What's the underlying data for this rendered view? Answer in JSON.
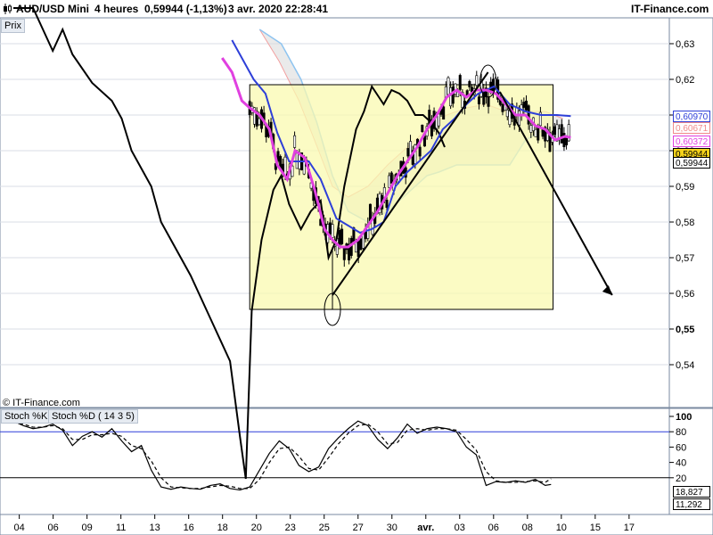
{
  "header": {
    "symbol": "AUD/USD Mini",
    "timeframe": "4 heures",
    "last_quote": "0,59944 (-1,13%)",
    "datetime": "3 avr. 2020 22:28:41",
    "brand": "IT-Finance.com"
  },
  "price_panel": {
    "tag": "Prix",
    "copyright": "© IT-Finance.com",
    "y_ticks": [
      "0,63",
      "0,62",
      "0,61",
      "0,60",
      "0,59",
      "0,58",
      "0,57",
      "0,56",
      "0,55",
      "0,54"
    ],
    "y_tick_values": [
      0.63,
      0.62,
      0.61,
      0.6,
      0.59,
      0.58,
      0.57,
      0.56,
      0.55,
      0.54
    ],
    "badges": [
      {
        "label": "0,60970",
        "value": 0.6097,
        "color": "#2e3fd8",
        "bg": "#ffffff"
      },
      {
        "label": "0,60671",
        "value": 0.60671,
        "color": "#f08a8a",
        "bg": "#ffffff"
      },
      {
        "label": "0,60372",
        "value": 0.60372,
        "color": "#e040e0",
        "bg": "#ffffff"
      },
      {
        "label": "0,59944",
        "value": 0.59944,
        "color": "#000000",
        "bg": "#f5d21a"
      },
      {
        "label": "0,59944",
        "value": 0.59944,
        "color": "#000000",
        "bg": "#ffffff"
      }
    ]
  },
  "stoch_panel": {
    "tag_k": "Stoch %K",
    "tag_d": "Stoch %D ( 14 3 5)",
    "y_ticks": [
      "100",
      "80",
      "60",
      "40",
      "20"
    ],
    "y_tick_values": [
      100,
      80,
      60,
      40,
      20
    ],
    "badges": [
      {
        "label": "18,827",
        "value": 18.827
      },
      {
        "label": "11,292",
        "value": 11.292
      }
    ]
  },
  "x_axis": {
    "labels": [
      "04",
      "06",
      "09",
      "11",
      "13",
      "16",
      "18",
      "20",
      "23",
      "25",
      "27",
      "30",
      "avr.",
      "03",
      "06",
      "08",
      "10",
      "15",
      "17"
    ]
  },
  "chart_data": [
    {
      "type": "candlestick",
      "title": "AUD/USD Mini",
      "ylim": [
        0.532,
        0.635
      ],
      "grid": true,
      "overlays": {
        "yellow_zone": {
          "x": [
            12,
            27.4
          ],
          "y": [
            0.5555,
            0.6185
          ]
        },
        "ellipses": [
          {
            "x": 16.2,
            "y": 0.5555
          },
          {
            "x": 24.1,
            "y": 0.6195
          }
        ],
        "trendlines": [
          {
            "x": [
              16.2,
              24.1
            ],
            "y": [
              0.5595,
              0.622
            ]
          },
          {
            "x": [
              24.7,
              30.4
            ],
            "y": [
              0.6165,
              0.5595
            ]
          }
        ]
      },
      "series": [
        {
          "name": "close",
          "values": [
            [
              0,
              0.64
            ],
            [
              1,
              0.64
            ],
            [
              2,
              0.628
            ],
            [
              2.5,
              0.634
            ],
            [
              3,
              0.627
            ],
            [
              4,
              0.619
            ],
            [
              5,
              0.614
            ],
            [
              5.5,
              0.609
            ],
            [
              6,
              0.6
            ],
            [
              7,
              0.59
            ],
            [
              7.5,
              0.58
            ],
            [
              8,
              0.575
            ],
            [
              9,
              0.565
            ],
            [
              10,
              0.553
            ],
            [
              11,
              0.541
            ],
            [
              11.5,
              0.52
            ],
            [
              11.8,
              0.508
            ],
            [
              12.1,
              0.555
            ],
            [
              12.6,
              0.575
            ],
            [
              13.2,
              0.589
            ],
            [
              13.6,
              0.593
            ],
            [
              14,
              0.585
            ],
            [
              14.6,
              0.578
            ],
            [
              15.1,
              0.583
            ],
            [
              15.6,
              0.586
            ],
            [
              16,
              0.57
            ],
            [
              16.4,
              0.575
            ],
            [
              16.8,
              0.59
            ],
            [
              17.4,
              0.606
            ],
            [
              17.8,
              0.611
            ],
            [
              18.2,
              0.618
            ],
            [
              18.8,
              0.613
            ],
            [
              19.2,
              0.617
            ],
            [
              19.6,
              0.616
            ],
            [
              20,
              0.614
            ],
            [
              20.4,
              0.61
            ],
            [
              20.8,
              0.61
            ],
            [
              21.2,
              0.608
            ],
            [
              21.6,
              0.605
            ],
            [
              21.9,
              0.601
            ]
          ]
        },
        {
          "name": "tenkan",
          "values": [
            [
              10.6,
              0.626
            ],
            [
              11.1,
              0.622
            ],
            [
              11.6,
              0.614
            ],
            [
              12,
              0.612
            ],
            [
              12.5,
              0.61
            ],
            [
              13,
              0.606
            ],
            [
              13.4,
              0.596
            ],
            [
              13.9,
              0.592
            ],
            [
              14.3,
              0.6
            ],
            [
              14.8,
              0.598
            ],
            [
              15.3,
              0.589
            ],
            [
              15.8,
              0.578
            ],
            [
              16.2,
              0.575
            ],
            [
              16.6,
              0.573
            ],
            [
              17,
              0.573
            ],
            [
              17.5,
              0.575
            ],
            [
              18,
              0.579
            ],
            [
              18.5,
              0.583
            ],
            [
              19,
              0.588
            ],
            [
              19.5,
              0.593
            ],
            [
              20,
              0.597
            ],
            [
              20.5,
              0.601
            ],
            [
              21,
              0.606
            ],
            [
              21.5,
              0.61
            ],
            [
              22,
              0.615
            ],
            [
              22.5,
              0.617
            ],
            [
              23,
              0.615
            ],
            [
              23.5,
              0.617
            ],
            [
              24,
              0.617
            ],
            [
              24.5,
              0.616
            ],
            [
              25,
              0.613
            ],
            [
              25.5,
              0.61
            ],
            [
              26,
              0.61
            ],
            [
              26.5,
              0.607
            ],
            [
              27,
              0.606
            ],
            [
              27.5,
              0.603
            ],
            [
              28,
              0.604
            ],
            [
              28.3,
              0.6037
            ]
          ]
        },
        {
          "name": "kijun",
          "values": [
            [
              11.1,
              0.631
            ],
            [
              11.7,
              0.625
            ],
            [
              12.2,
              0.62
            ],
            [
              12.8,
              0.616
            ],
            [
              13.4,
              0.605
            ],
            [
              14,
              0.597
            ],
            [
              15,
              0.597
            ],
            [
              15.6,
              0.592
            ],
            [
              16.4,
              0.581
            ],
            [
              17,
              0.579
            ],
            [
              17.6,
              0.577
            ],
            [
              18.2,
              0.578
            ],
            [
              18.8,
              0.58
            ],
            [
              19.4,
              0.59
            ],
            [
              20,
              0.594
            ],
            [
              20.6,
              0.597
            ],
            [
              21.2,
              0.6
            ],
            [
              21.8,
              0.606
            ],
            [
              22.4,
              0.609
            ],
            [
              23,
              0.613
            ],
            [
              23.6,
              0.616
            ],
            [
              24.4,
              0.618
            ],
            [
              25.2,
              0.613
            ],
            [
              26,
              0.611
            ],
            [
              26.8,
              0.61
            ],
            [
              27.6,
              0.61
            ],
            [
              28.3,
              0.6097
            ]
          ]
        },
        {
          "name": "stoch_k",
          "values": [
            [
              0,
              94
            ],
            [
              0.5,
              88
            ],
            [
              1,
              84
            ],
            [
              1.5,
              86
            ],
            [
              2,
              90
            ],
            [
              2.5,
              82
            ],
            [
              3,
              62
            ],
            [
              3.5,
              74
            ],
            [
              4,
              80
            ],
            [
              4.5,
              73
            ],
            [
              5,
              84
            ],
            [
              5.5,
              68
            ],
            [
              6,
              54
            ],
            [
              6.5,
              62
            ],
            [
              7,
              30
            ],
            [
              7.5,
              8
            ],
            [
              8,
              5
            ],
            [
              8.5,
              8
            ],
            [
              9,
              6
            ],
            [
              9.5,
              5
            ],
            [
              10,
              10
            ],
            [
              10.5,
              12
            ],
            [
              11,
              6
            ],
            [
              11.5,
              4
            ],
            [
              12,
              8
            ],
            [
              12.5,
              30
            ],
            [
              13,
              52
            ],
            [
              13.5,
              68
            ],
            [
              14,
              58
            ],
            [
              14.5,
              36
            ],
            [
              15,
              28
            ],
            [
              15.5,
              34
            ],
            [
              16,
              58
            ],
            [
              16.5,
              72
            ],
            [
              17,
              84
            ],
            [
              17.5,
              94
            ],
            [
              18,
              88
            ],
            [
              18.5,
              70
            ],
            [
              19,
              58
            ],
            [
              19.5,
              72
            ],
            [
              20,
              90
            ],
            [
              20.5,
              78
            ],
            [
              21,
              84
            ],
            [
              21.5,
              86
            ],
            [
              22,
              84
            ],
            [
              22.5,
              80
            ],
            [
              23,
              60
            ],
            [
              23.5,
              50
            ],
            [
              24,
              10
            ],
            [
              24.5,
              15
            ],
            [
              25,
              14
            ],
            [
              25.5,
              16
            ],
            [
              26,
              14
            ],
            [
              26.5,
              18
            ],
            [
              27,
              10
            ],
            [
              27.3,
              11.3
            ]
          ]
        },
        {
          "name": "stoch_d",
          "values": [
            [
              0,
              92
            ],
            [
              0.5,
              90
            ],
            [
              1,
              86
            ],
            [
              1.5,
              86
            ],
            [
              2,
              88
            ],
            [
              2.5,
              84
            ],
            [
              3,
              70
            ],
            [
              3.5,
              70
            ],
            [
              4,
              76
            ],
            [
              4.5,
              76
            ],
            [
              5,
              78
            ],
            [
              5.5,
              74
            ],
            [
              6,
              62
            ],
            [
              6.5,
              58
            ],
            [
              7,
              42
            ],
            [
              7.5,
              20
            ],
            [
              8,
              8
            ],
            [
              8.5,
              7
            ],
            [
              9,
              6
            ],
            [
              9.5,
              6
            ],
            [
              10,
              8
            ],
            [
              10.5,
              10
            ],
            [
              11,
              9
            ],
            [
              11.5,
              6
            ],
            [
              12,
              6
            ],
            [
              12.5,
              18
            ],
            [
              13,
              40
            ],
            [
              13.5,
              58
            ],
            [
              14,
              60
            ],
            [
              14.5,
              48
            ],
            [
              15,
              32
            ],
            [
              15.5,
              30
            ],
            [
              16,
              46
            ],
            [
              16.5,
              64
            ],
            [
              17,
              78
            ],
            [
              17.5,
              88
            ],
            [
              18,
              90
            ],
            [
              18.5,
              80
            ],
            [
              19,
              64
            ],
            [
              19.5,
              66
            ],
            [
              20,
              82
            ],
            [
              20.5,
              84
            ],
            [
              21,
              82
            ],
            [
              21.5,
              84
            ],
            [
              22,
              84
            ],
            [
              22.5,
              82
            ],
            [
              23,
              70
            ],
            [
              23.5,
              56
            ],
            [
              24,
              28
            ],
            [
              24.5,
              16
            ],
            [
              25,
              14
            ],
            [
              25.5,
              14
            ],
            [
              26,
              15
            ],
            [
              26.5,
              16
            ],
            [
              27,
              14
            ],
            [
              27.3,
              18.8
            ]
          ]
        }
      ]
    }
  ]
}
